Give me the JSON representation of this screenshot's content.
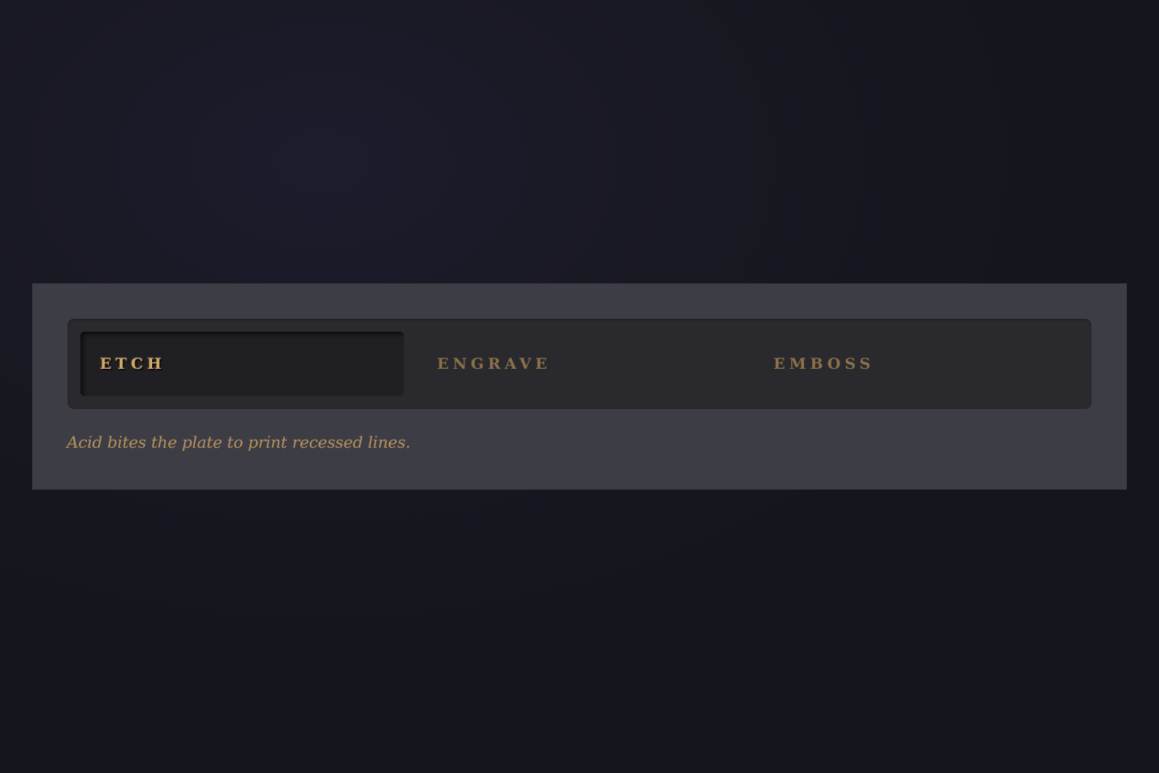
{
  "tabs": [
    {
      "label": "ETCH",
      "active": true
    },
    {
      "label": "ENGRAVE",
      "active": false
    },
    {
      "label": "EMBOSS",
      "active": false
    }
  ],
  "caption": "Acid bites the plate to print recessed lines.",
  "colors": {
    "accent_active": "#d2a868",
    "accent_inactive": "#8b7049",
    "panel": "#3d3d46",
    "tabbar": "#2a292e",
    "background": "#181822"
  }
}
